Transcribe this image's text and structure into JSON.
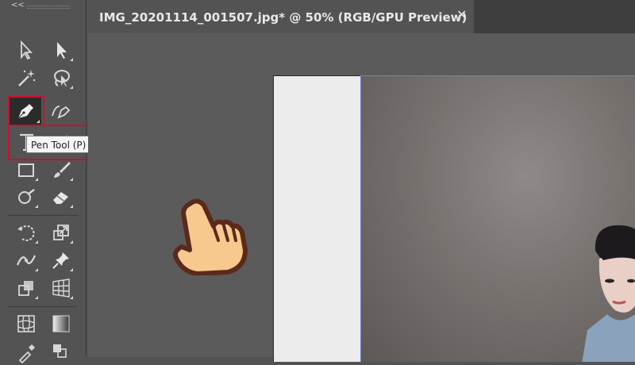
{
  "toolbar": {
    "collapse_label": "<<",
    "tooltip": "Pen Tool (P)",
    "tools": [
      "selection-tool",
      "direct-selection-tool",
      "magic-wand-tool",
      "lasso-tool",
      "pen-tool",
      "curvature-tool",
      "type-tool",
      "line-segment-tool",
      "rectangle-tool",
      "paintbrush-tool",
      "shaper-tool",
      "eraser-tool",
      "rotate-tool",
      "scale-tool",
      "width-tool",
      "puppet-warp-tool",
      "shape-builder-tool",
      "perspective-grid-tool",
      "mesh-tool",
      "gradient-tool",
      "eyedropper-tool",
      "blend-tool"
    ],
    "active_tool": "pen-tool"
  },
  "document": {
    "tab_title": "IMG_20201114_001507.jpg* @ 50% (RGB/GPU Preview)",
    "close_label": "✕"
  },
  "colors": {
    "highlight": "#c8102e",
    "selection": "#6a7fd8"
  }
}
